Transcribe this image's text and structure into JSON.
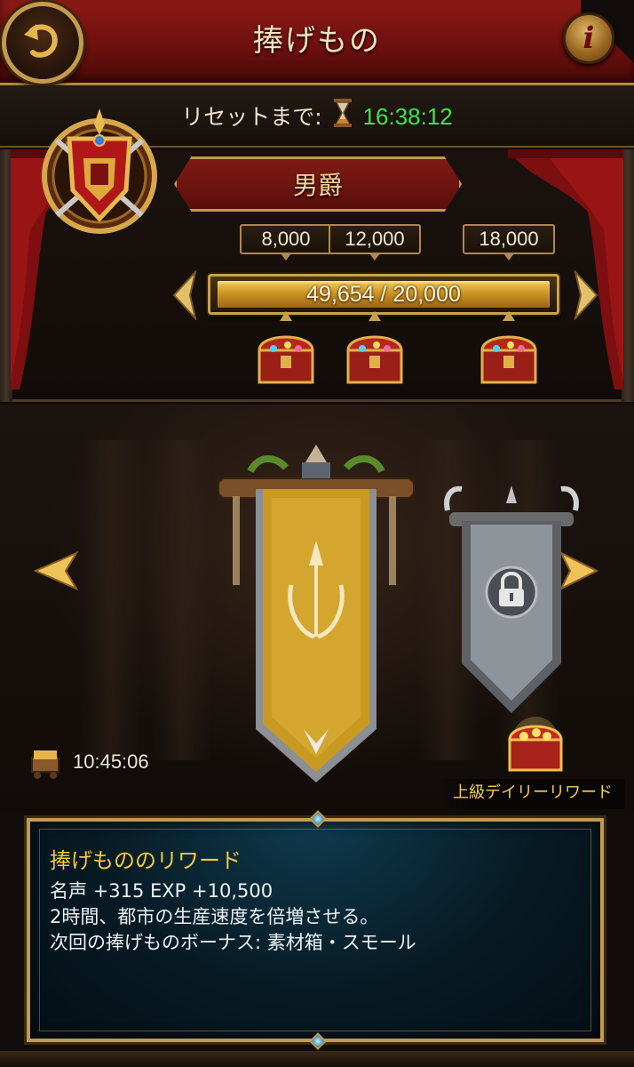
{
  "header": {
    "title": "捧げもの"
  },
  "reset": {
    "label": "リセットまで:",
    "timer": "16:38:12"
  },
  "rank": {
    "title": "男爵",
    "milestones": [
      "8,000",
      "12,000",
      "18,000"
    ],
    "progress_text": "49,654 / 20,000",
    "progress_fraction": 1.0
  },
  "tribute": {
    "cooldown": "10:45:06",
    "premium_label": "上級デイリーリワード"
  },
  "reward_panel": {
    "title": "捧げもののリワード",
    "line1": "名声 +315 EXP +10,500",
    "line2": "2時間、都市の生産速度を倍増させる。",
    "line3": "次回の捧げものボーナス: 素材箱・スモール"
  },
  "colors": {
    "title_red": "#7a1410",
    "gold_frame": "#c49a4c",
    "timer_green": "#3fe24a",
    "reward_title_yellow": "#f4c83b",
    "panel_teal": "#0f3a4e"
  },
  "icons": {
    "back": "back-arrow-icon",
    "info": "info-icon",
    "hourglass": "hourglass-icon",
    "emblem": "baron-emblem-icon",
    "chest": "treasure-chest-icon",
    "lock": "lock-icon",
    "cooldown": "gold-cart-icon"
  }
}
